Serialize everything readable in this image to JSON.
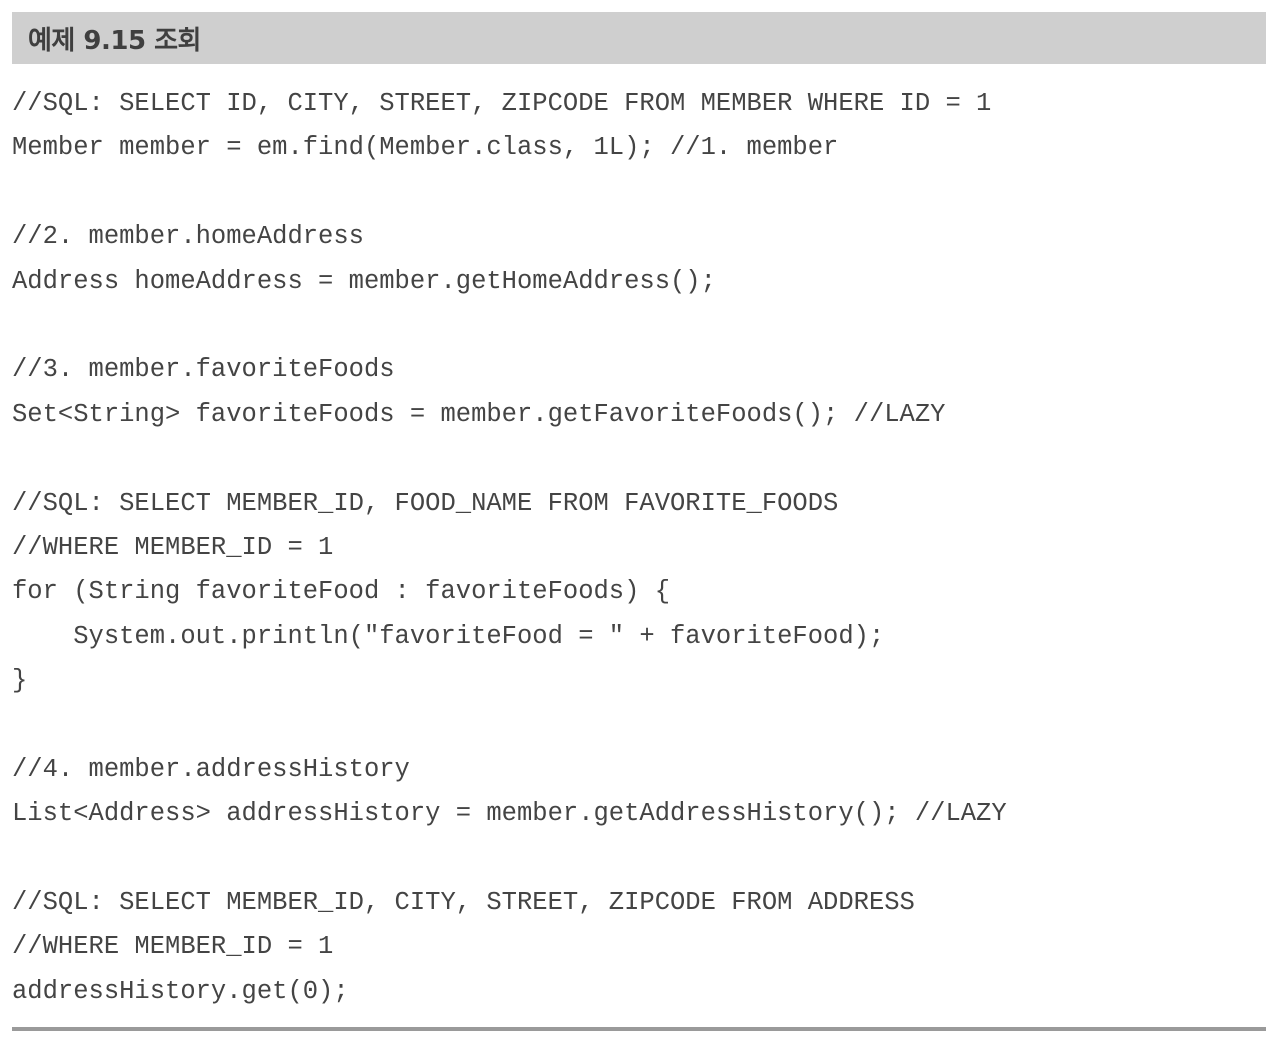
{
  "header": {
    "title": "예제 9.15 조회"
  },
  "code": {
    "lines": [
      "//SQL: SELECT ID, CITY, STREET, ZIPCODE FROM MEMBER WHERE ID = 1",
      "Member member = em.find(Member.class, 1L); //1. member",
      "",
      "//2. member.homeAddress",
      "Address homeAddress = member.getHomeAddress();",
      "",
      "//3. member.favoriteFoods",
      "Set<String> favoriteFoods = member.getFavoriteFoods(); //LAZY",
      "",
      "//SQL: SELECT MEMBER_ID, FOOD_NAME FROM FAVORITE_FOODS",
      "//WHERE MEMBER_ID = 1",
      "for (String favoriteFood : favoriteFoods) {",
      "    System.out.println(\"favoriteFood = \" + favoriteFood);",
      "}",
      "",
      "//4. member.addressHistory",
      "List<Address> addressHistory = member.getAddressHistory(); //LAZY",
      "",
      "//SQL: SELECT MEMBER_ID, CITY, STREET, ZIPCODE FROM ADDRESS",
      "//WHERE MEMBER_ID = 1",
      "addressHistory.get(0);"
    ]
  }
}
